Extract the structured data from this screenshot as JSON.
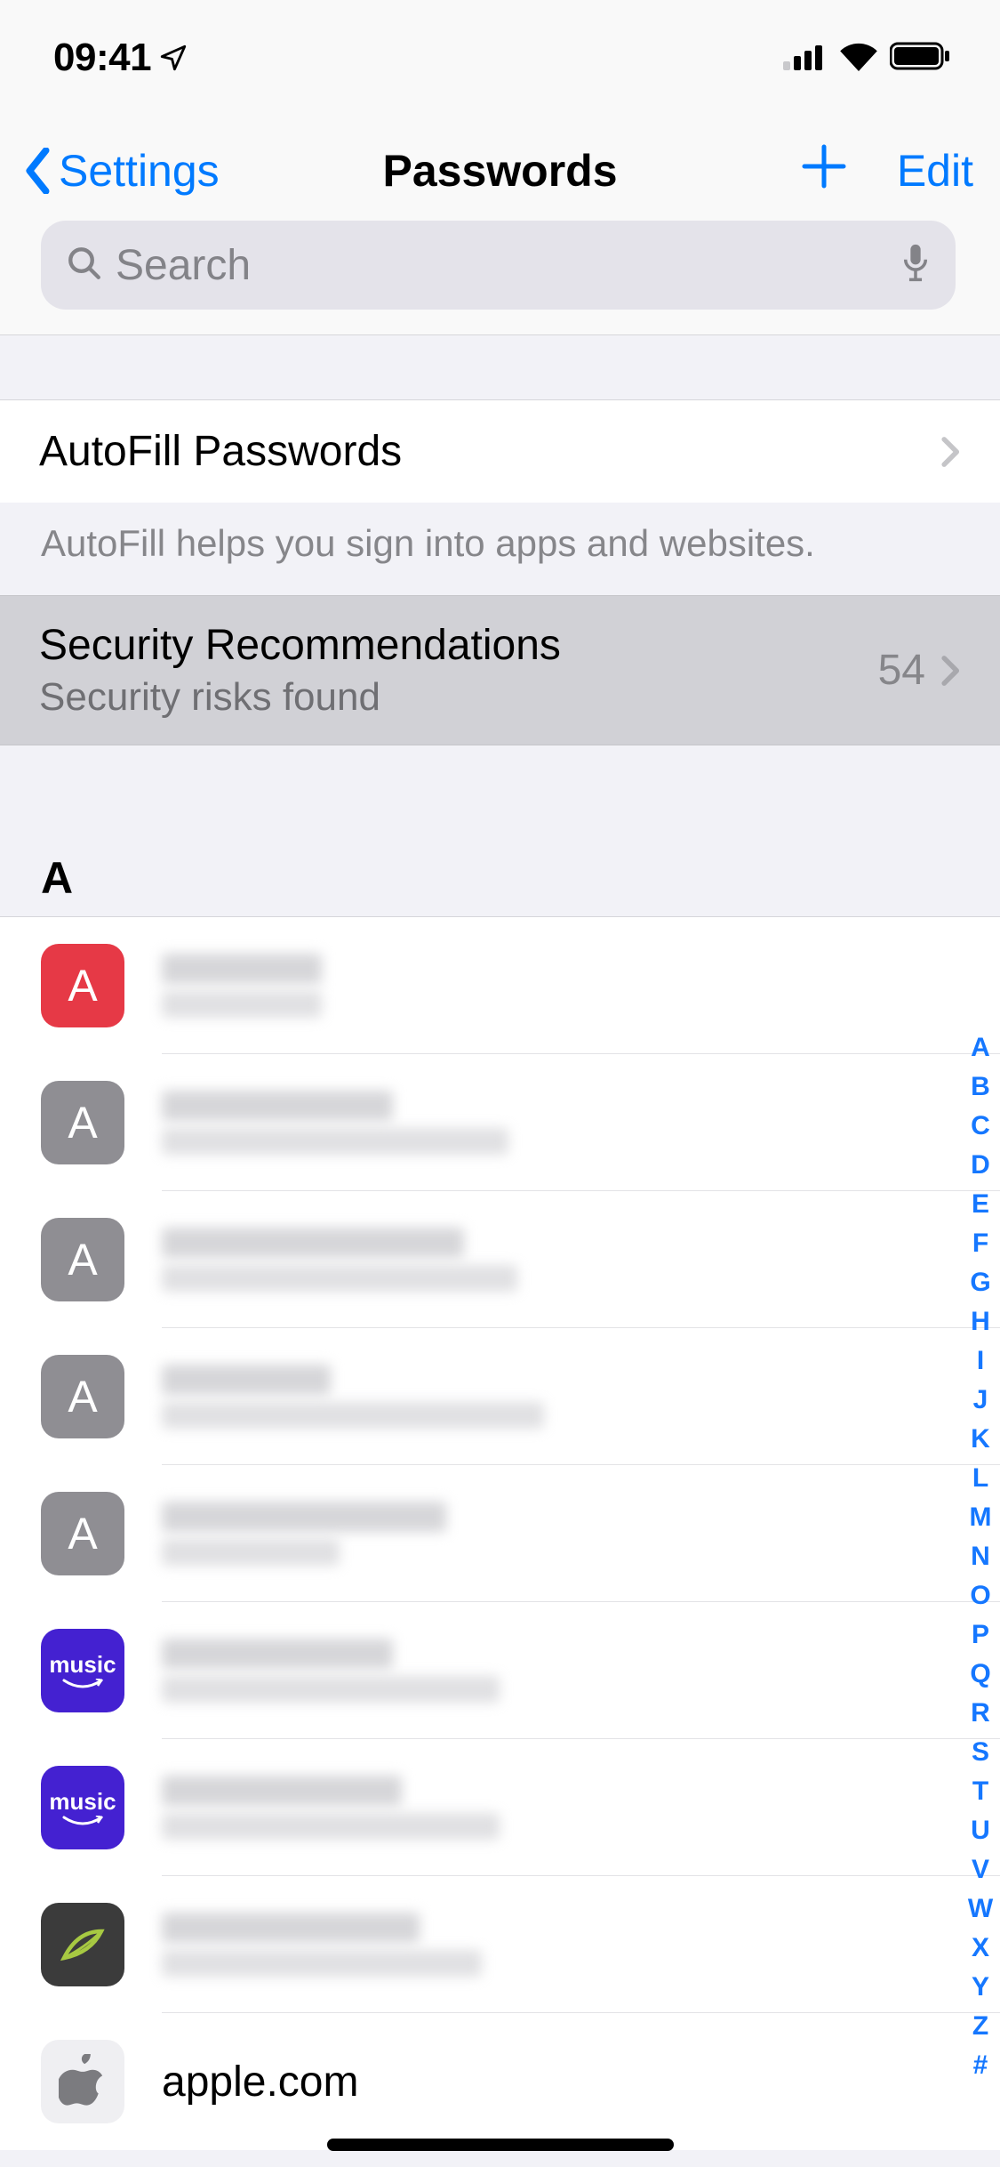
{
  "status": {
    "time": "09:41"
  },
  "nav": {
    "back": "Settings",
    "title": "Passwords",
    "edit": "Edit"
  },
  "search": {
    "placeholder": "Search"
  },
  "autofill": {
    "label": "AutoFill Passwords",
    "note": "AutoFill helps you sign into apps and websites."
  },
  "security": {
    "title": "Security Recommendations",
    "subtitle": "Security risks found",
    "count": "54"
  },
  "section": {
    "header": "A"
  },
  "entries": [
    {
      "letter": "A",
      "iconClass": "icon-red",
      "redacted": true,
      "w1": 180,
      "w2": 180
    },
    {
      "letter": "A",
      "iconClass": "icon-gray",
      "redacted": true,
      "w1": 260,
      "w2": 390
    },
    {
      "letter": "A",
      "iconClass": "icon-gray",
      "redacted": true,
      "w1": 340,
      "w2": 400
    },
    {
      "letter": "A",
      "iconClass": "icon-gray",
      "redacted": true,
      "w1": 190,
      "w2": 430
    },
    {
      "letter": "A",
      "iconClass": "icon-gray",
      "redacted": true,
      "w1": 320,
      "w2": 200
    },
    {
      "letter": "",
      "iconClass": "icon-music",
      "redacted": true,
      "w1": 260,
      "w2": 380,
      "iconLabel": "music"
    },
    {
      "letter": "",
      "iconClass": "icon-music",
      "redacted": true,
      "w1": 270,
      "w2": 380,
      "iconLabel": "music"
    },
    {
      "letter": "",
      "iconClass": "icon-ancestry",
      "redacted": true,
      "w1": 290,
      "w2": 360,
      "svg": "leaf"
    },
    {
      "letter": "",
      "iconClass": "icon-apple",
      "redacted": false,
      "title": "apple.com",
      "svg": "apple"
    }
  ],
  "index": [
    "A",
    "B",
    "C",
    "D",
    "E",
    "F",
    "G",
    "H",
    "I",
    "J",
    "K",
    "L",
    "M",
    "N",
    "O",
    "P",
    "Q",
    "R",
    "S",
    "T",
    "U",
    "V",
    "W",
    "X",
    "Y",
    "Z",
    "#"
  ]
}
